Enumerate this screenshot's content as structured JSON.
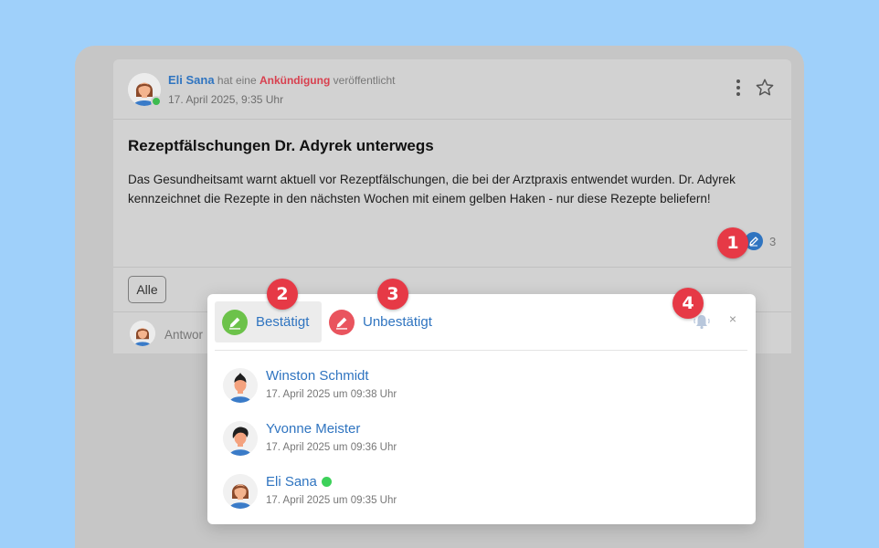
{
  "post": {
    "author": "Eli Sana",
    "action_prefix": "hat eine",
    "action_type": "Ankündigung",
    "action_suffix": "veröffentlicht",
    "date": "17. April 2025, 9:35 Uhr",
    "title": "Rezeptfälschungen Dr. Adyrek unterwegs",
    "body": "Das Gesundheitsamt warnt aktuell vor Rezeptfälschungen, die bei der Arztpraxis entwendet wurden. Dr. Adyrek kennzeichnet die Rezepte in den nächsten Wochen mit einem gelben Haken - nur diese Rezepte beliefern!",
    "reaction_count": "3",
    "filter_label": "Alle",
    "reply_placeholder": "Antwor"
  },
  "popup": {
    "tabs": [
      {
        "label": "Bestätigt",
        "active": true
      },
      {
        "label": "Unbestätigt",
        "active": false
      }
    ],
    "close_glyph": "×",
    "confirmations": [
      {
        "name": "Winston Schmidt",
        "date": "17. April 2025 um 09:38 Uhr",
        "online": false
      },
      {
        "name": "Yvonne Meister",
        "date": "17. April 2025 um 09:36 Uhr",
        "online": false
      },
      {
        "name": "Eli Sana",
        "date": "17. April 2025 um 09:35 Uhr",
        "online": true
      }
    ]
  },
  "badges": [
    "1",
    "2",
    "3",
    "4"
  ],
  "colors": {
    "background": "#9fd0fa",
    "link": "#2f74c0",
    "announcement": "#d8404f",
    "confirmed": "#6cc24a",
    "unconfirmed": "#e9545e",
    "badge": "#e63946",
    "online": "#3dd15a"
  },
  "icons": [
    "kebab-menu-icon",
    "star-icon",
    "pen-icon",
    "bell-icon",
    "close-icon"
  ]
}
